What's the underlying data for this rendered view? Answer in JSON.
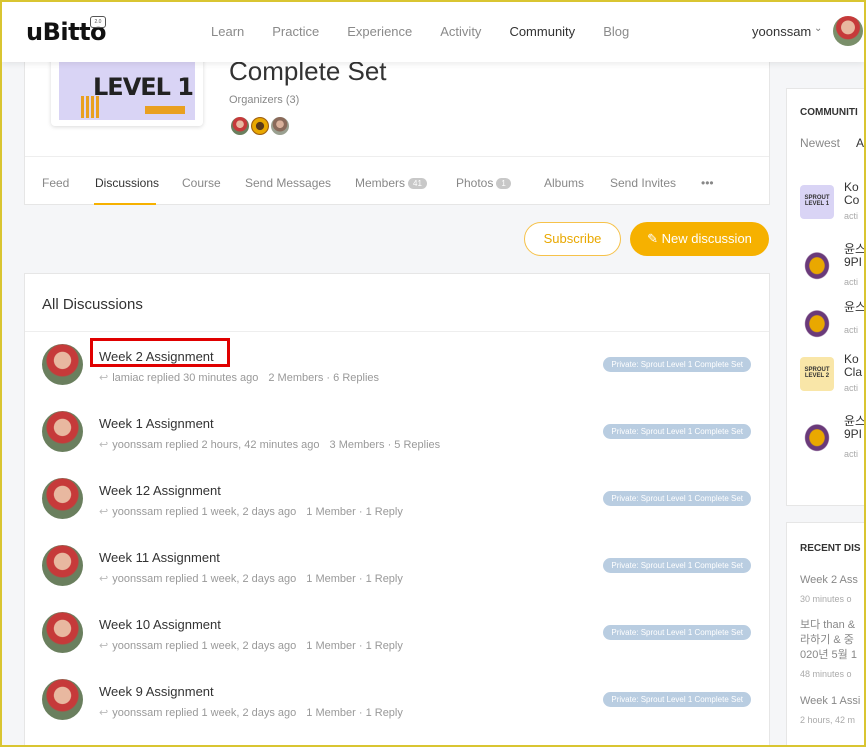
{
  "header": {
    "logo": "uBitto",
    "nav": [
      "Learn",
      "Practice",
      "Experience",
      "Activity",
      "Community",
      "Blog"
    ],
    "active_nav": "Community",
    "username": "yoonssam"
  },
  "group": {
    "cover_text": "LEVEL 1",
    "title": "Complete Set",
    "organizers_label": "Organizers (3)"
  },
  "tabs": [
    {
      "label": "Feed"
    },
    {
      "label": "Discussions"
    },
    {
      "label": "Course"
    },
    {
      "label": "Send Messages"
    },
    {
      "label": "Members",
      "badge": "41"
    },
    {
      "label": "Photos",
      "badge": "1"
    },
    {
      "label": "Albums"
    },
    {
      "label": "Send Invites"
    },
    {
      "label": "•••"
    }
  ],
  "actions": {
    "subscribe": "Subscribe",
    "new_discussion": "New discussion"
  },
  "discussions": {
    "title": "All Discussions",
    "items": [
      {
        "title": "Week 2 Assignment",
        "meta": "lamiac replied 30 minutes ago",
        "stats": "2 Members · 6 Replies",
        "tag": "Private: Sprout Level 1 Complete Set"
      },
      {
        "title": "Week 1 Assignment",
        "meta": "yoonssam replied 2 hours, 42 minutes ago",
        "stats": "3 Members · 5 Replies",
        "tag": "Private: Sprout Level 1 Complete Set"
      },
      {
        "title": "Week 12 Assignment",
        "meta": "yoonssam replied 1 week, 2 days ago",
        "stats": "1 Member · 1 Reply",
        "tag": "Private: Sprout Level 1 Complete Set"
      },
      {
        "title": "Week 11 Assignment",
        "meta": "yoonssam replied 1 week, 2 days ago",
        "stats": "1 Member · 1 Reply",
        "tag": "Private: Sprout Level 1 Complete Set"
      },
      {
        "title": "Week 10 Assignment",
        "meta": "yoonssam replied 1 week, 2 days ago",
        "stats": "1 Member · 1 Reply",
        "tag": "Private: Sprout Level 1 Complete Set"
      },
      {
        "title": "Week 9 Assignment",
        "meta": "yoonssam replied 1 week, 2 days ago",
        "stats": "1 Member · 1 Reply",
        "tag": "Private: Sprout Level 1 Complete Set"
      }
    ]
  },
  "sidebar": {
    "communities_title": "COMMUNITI",
    "tab_newest": "Newest",
    "tab_other": "A",
    "items": [
      {
        "name1": "Ko",
        "name2": "Co",
        "sub": "acti",
        "thumb": "SPROUT LEVEL 1"
      },
      {
        "name1": "윤스",
        "name2": "9PI",
        "sub": "acti"
      },
      {
        "name1": "윤스",
        "name2": "",
        "sub": "acti"
      },
      {
        "name1": "Ko",
        "name2": "Cla",
        "sub": "acti",
        "thumb": "SPROUT LEVEL 2"
      },
      {
        "name1": "윤스",
        "name2": "9PI",
        "sub": "acti"
      }
    ],
    "recent_title": "RECENT DIS",
    "recent": [
      {
        "lines": [
          "Week 2 Ass"
        ],
        "sub": "30 minutes o"
      },
      {
        "lines": [
          "보다 than &",
          "라하기 & 중",
          "020년 5월 1"
        ],
        "sub": "48 minutes o"
      },
      {
        "lines": [
          "Week 1 Assi"
        ],
        "sub": "2 hours, 42 m"
      }
    ]
  }
}
